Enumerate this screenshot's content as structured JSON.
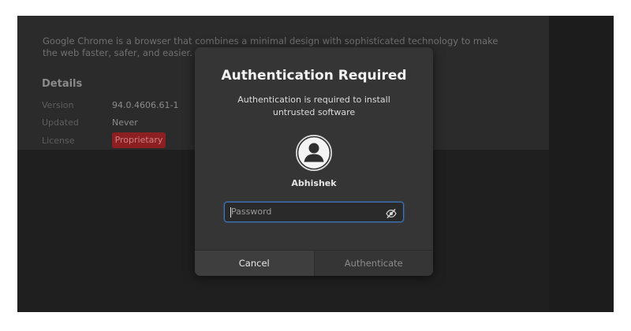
{
  "background_app": {
    "description": "Google Chrome is a browser that combines a minimal design with sophisticated technology to make the web faster, safer, and easier.",
    "details_title": "Details",
    "details": [
      {
        "label": "Version",
        "value": "94.0.4606.61-1"
      },
      {
        "label": "Updated",
        "value": "Never"
      },
      {
        "label": "License",
        "value": "Proprietary"
      }
    ]
  },
  "dialog": {
    "title": "Authentication Required",
    "message": "Authentication is required to install untrusted software",
    "avatar_icon": "user-avatar-icon",
    "user_name": "Abhishek",
    "password": {
      "value": "",
      "placeholder": "Password",
      "toggle_icon": "eye-slash-icon"
    },
    "actions": {
      "cancel_label": "Cancel",
      "authenticate_label": "Authenticate"
    }
  },
  "colors": {
    "dialog_bg": "#353535",
    "focus_accent": "#3a75c0",
    "license_badge": "#8b1f22"
  }
}
